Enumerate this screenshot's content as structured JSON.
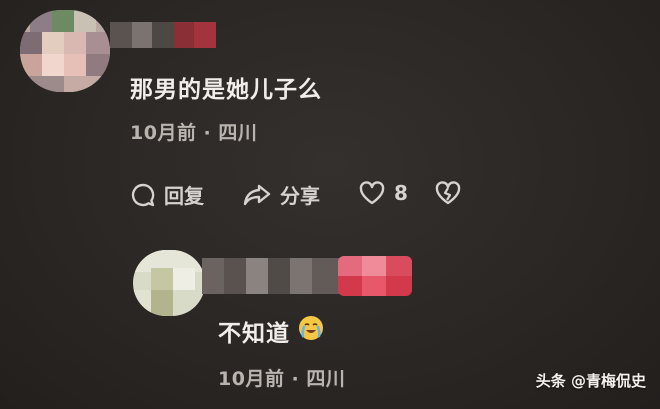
{
  "comment": {
    "text": "那男的是她儿子么",
    "meta": "10月前 · 四川",
    "actions": {
      "reply_label": "回复",
      "share_label": "分享",
      "like_count": "8"
    }
  },
  "reply": {
    "text": "不知道",
    "emoji": "😭",
    "meta": "10月前 · 四川"
  },
  "watermark": {
    "text": "头条 @青梅侃史"
  },
  "colors": {
    "background": "#2a2624",
    "text": "#f1eeea",
    "meta": "#b9b4ae",
    "badge_red": "#e0374a"
  },
  "icons": [
    "comment-bubble-icon",
    "share-arrow-icon",
    "heart-icon",
    "broken-heart-icon",
    "crying-emoji-icon"
  ]
}
